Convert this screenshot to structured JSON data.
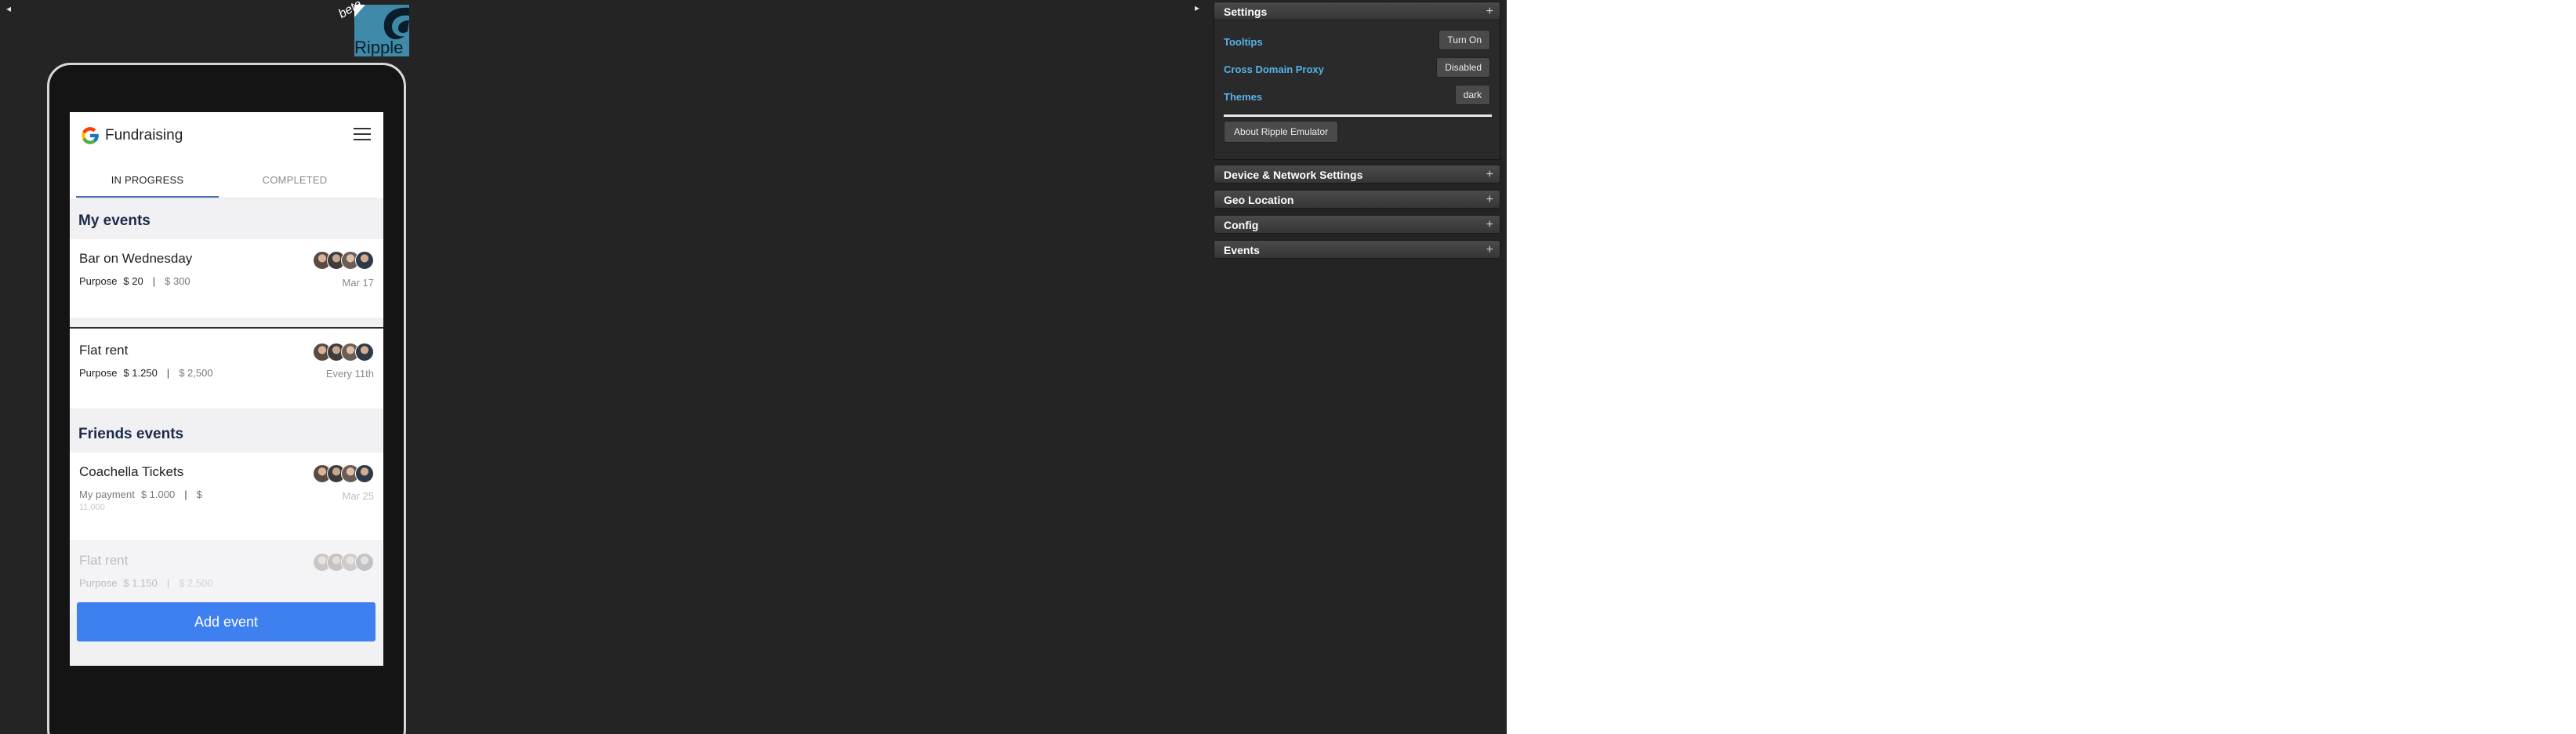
{
  "emulator": {
    "logo_badge": "beta",
    "logo_text": "Ripple",
    "collapse_left_icon": "arrow-left-icon",
    "collapse_right_icon": "arrow-right-icon"
  },
  "app": {
    "title": "Fundraising",
    "tabs": [
      {
        "label": "IN PROGRESS",
        "active": true
      },
      {
        "label": "COMPLETED",
        "active": false
      }
    ],
    "my_events_heading": "My events",
    "my_events": [
      {
        "title": "Bar on Wednesday",
        "type": "Purpose",
        "amount": "$ 20",
        "separator": "|",
        "goal": "$ 300",
        "date": "Mar 17"
      },
      {
        "title": "Flat rent",
        "type": "Purpose",
        "amount": "$ 1.250",
        "separator": "|",
        "goal": "$ 2,500",
        "date": "Every 11th"
      }
    ],
    "friends_events_heading": "Friends events",
    "friends_events": [
      {
        "title": "Coachella Tickets",
        "type": "My payment",
        "amount": "$ 1.000",
        "separator": "|",
        "goal": "$",
        "goal_wrap": "11,000",
        "date": "Mar 25"
      },
      {
        "title": "Flat rent",
        "type": "Purpose",
        "amount": "$ 1.150",
        "separator": "|",
        "goal": "$ 2,500",
        "date": ""
      }
    ],
    "add_button": "Add event",
    "accent_color": "#3f80f0"
  },
  "panel": {
    "settings": {
      "title": "Settings",
      "tooltips_label": "Tooltips",
      "tooltips_value": "Turn On",
      "proxy_label": "Cross Domain Proxy",
      "proxy_value": "Disabled",
      "themes_label": "Themes",
      "themes_value": "dark",
      "about_button": "About Ripple Emulator"
    },
    "sections": [
      {
        "title": "Device & Network Settings"
      },
      {
        "title": "Geo Location"
      },
      {
        "title": "Config"
      },
      {
        "title": "Events"
      }
    ],
    "expand_icon": "plus-icon"
  }
}
